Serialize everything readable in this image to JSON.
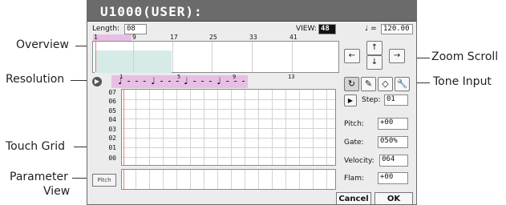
{
  "title": "U1000(USER):",
  "length": {
    "label": "Length:",
    "value": "08"
  },
  "view": {
    "label": "VIEW:",
    "value": "48"
  },
  "tempo": {
    "symbol": "♩ =",
    "value": "120.00"
  },
  "overview_ruler": [
    "1",
    "9",
    "17",
    "25",
    "33",
    "41"
  ],
  "resolution_ruler": [
    "1",
    "5",
    "9",
    "13"
  ],
  "resolution_notes": "♩ - - - ♩ - - - ♩ - - - ♩ - - -",
  "grid_rows": [
    "07",
    "06",
    "05",
    "04",
    "03",
    "02",
    "01",
    "00"
  ],
  "param_button": "Pitch",
  "zoom": {
    "up": "↑",
    "down": "↓",
    "left": "←",
    "right": "→"
  },
  "tools": [
    {
      "name": "loop-icon",
      "glyph": "↻"
    },
    {
      "name": "pencil-icon",
      "glyph": "✎"
    },
    {
      "name": "eraser-icon",
      "glyph": "◇"
    },
    {
      "name": "wrench-icon",
      "glyph": "🔧"
    }
  ],
  "step_panel": {
    "play": "▶",
    "step_label": "Step:",
    "step_value": "01",
    "pitch_label": "Pitch:",
    "pitch_value": "+00",
    "gate_label": "Gate:",
    "gate_value": "050%",
    "velocity_label": "Velocity:",
    "velocity_value": "064",
    "flam_label": "Flam:",
    "flam_value": "+00"
  },
  "buttons": {
    "cancel": "Cancel",
    "ok": "OK"
  },
  "callouts": {
    "overview": "Overview",
    "resolution": "Resolution",
    "touch_grid": "Touch Grid",
    "parameter_view_1": "Parameter",
    "parameter_view_2": "View",
    "zoom_scroll": "Zoom Scroll",
    "tone_input": "Tone Input"
  },
  "colors": {
    "title_bg": "#6b6b6b",
    "highlight": "#e8bfe4",
    "range": "#d6ebe8",
    "cursor": "#e58080"
  }
}
